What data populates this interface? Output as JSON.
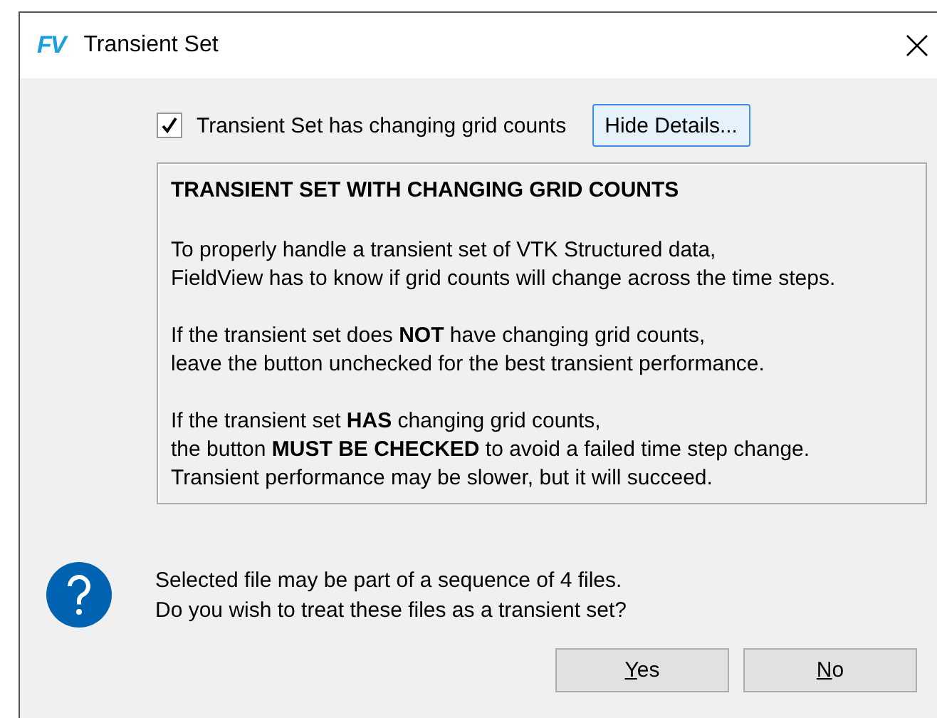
{
  "window": {
    "logo": "FV",
    "title": "Transient Set"
  },
  "option": {
    "label": "Transient Set has changing grid counts",
    "checked": true
  },
  "details_button": "Hide Details...",
  "details": {
    "heading": "TRANSIENT SET WITH CHANGING GRID COUNTS",
    "paragraphs": [
      "To properly handle a transient set of VTK Structured data,\nFieldView has to know if grid counts will change across the time steps.",
      "If the transient set does **NOT** have changing grid counts,\nleave the button unchecked for the best transient performance.",
      "If the transient set **HAS** changing grid counts,\nthe button **MUST BE CHECKED** to avoid a failed time step change.\nTransient performance may be slower, but it will succeed."
    ]
  },
  "message": "Selected file may be part of a sequence of 4 files.\nDo you wish to treat these files as a transient set?",
  "buttons": [
    {
      "mnemonic": "Y",
      "rest": "es"
    },
    {
      "mnemonic": "N",
      "rest": "o"
    }
  ]
}
